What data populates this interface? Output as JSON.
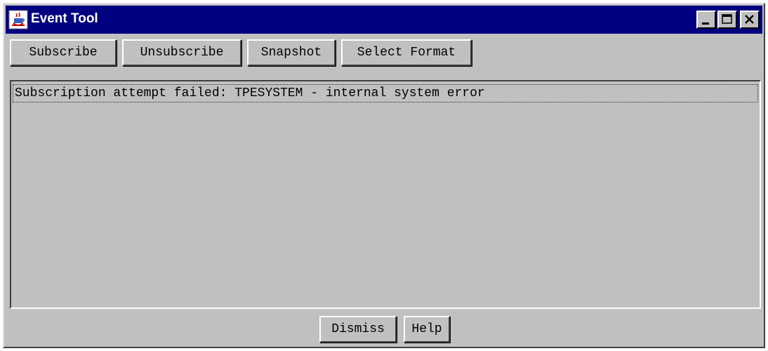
{
  "window": {
    "title": "Event Tool",
    "controls": [
      "minimize-icon",
      "maximize-icon",
      "close-icon"
    ]
  },
  "toolbar": {
    "subscribe_label": "Subscribe",
    "unsubscribe_label": "Unsubscribe",
    "snapshot_label": "Snapshot",
    "select_format_label": "Select Format"
  },
  "messages": [
    "Subscription attempt failed: TPESYSTEM - internal system error"
  ],
  "footer": {
    "dismiss_label": "Dismiss",
    "help_label": "Help"
  },
  "colors": {
    "title_bar": "#000080",
    "window_face": "#c0c0c0"
  }
}
